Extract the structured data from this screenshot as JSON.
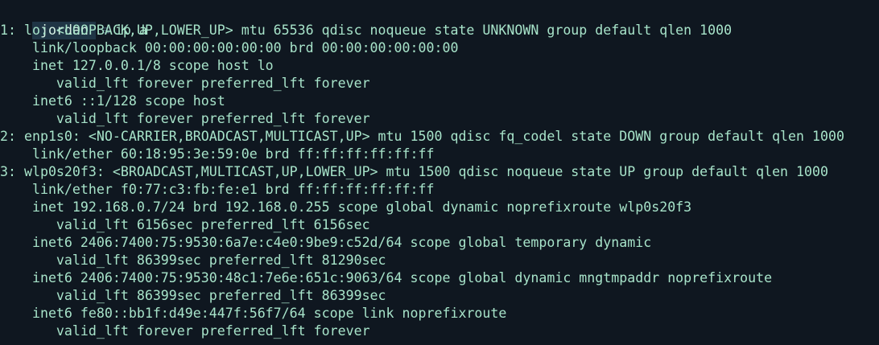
{
  "prompt": {
    "user": "jordan",
    "separator": "≡",
    "command": "ip a"
  },
  "output_lines": [
    "1: lo: <LOOPBACK,UP,LOWER_UP> mtu 65536 qdisc noqueue state UNKNOWN group default qlen 1000",
    "    link/loopback 00:00:00:00:00:00 brd 00:00:00:00:00:00",
    "    inet 127.0.0.1/8 scope host lo",
    "       valid_lft forever preferred_lft forever",
    "    inet6 ::1/128 scope host",
    "       valid_lft forever preferred_lft forever",
    "2: enp1s0: <NO-CARRIER,BROADCAST,MULTICAST,UP> mtu 1500 qdisc fq_codel state DOWN group default qlen 1000",
    "    link/ether 60:18:95:3e:59:0e brd ff:ff:ff:ff:ff:ff",
    "3: wlp0s20f3: <BROADCAST,MULTICAST,UP,LOWER_UP> mtu 1500 qdisc noqueue state UP group default qlen 1000",
    "    link/ether f0:77:c3:fb:fe:e1 brd ff:ff:ff:ff:ff:ff",
    "    inet 192.168.0.7/24 brd 192.168.0.255 scope global dynamic noprefixroute wlp0s20f3",
    "       valid_lft 6156sec preferred_lft 6156sec",
    "    inet6 2406:7400:75:9530:6a7e:c4e0:9be9:c52d/64 scope global temporary dynamic",
    "       valid_lft 86399sec preferred_lft 81290sec",
    "    inet6 2406:7400:75:9530:48c1:7e6e:651c:9063/64 scope global dynamic mngtmpaddr noprefixroute",
    "       valid_lft 86399sec preferred_lft 86399sec",
    "    inet6 fe80::bb1f:d49e:447f:56f7/64 scope link noprefixroute",
    "       valid_lft forever preferred_lft forever"
  ]
}
